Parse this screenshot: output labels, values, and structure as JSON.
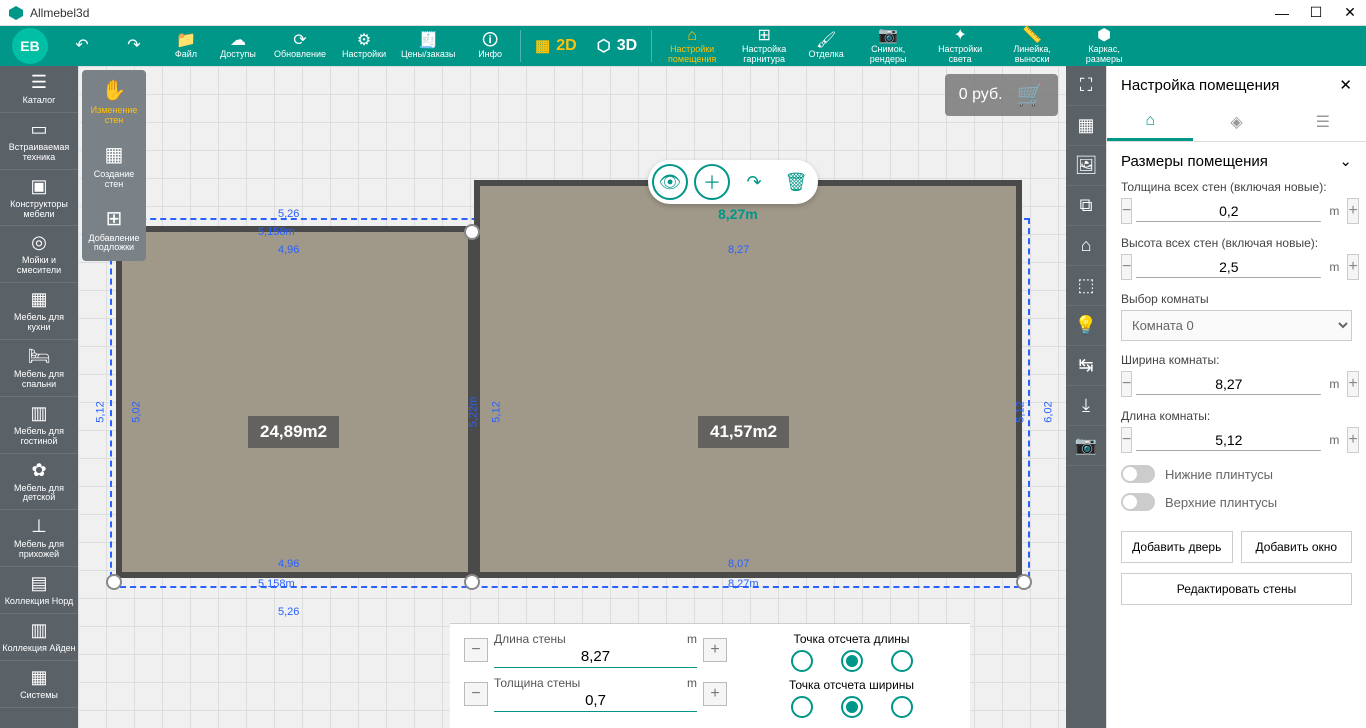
{
  "title": "Allmebel3d",
  "toolbar": {
    "eb": "ЕВ",
    "file": "Файл",
    "access": "Доступы",
    "update": "Обновление",
    "settings": "Настройки",
    "prices": "Цены/заказы",
    "info": "Инфо",
    "v2d": "2D",
    "v3d": "3D",
    "roomset_l1": "Настройки",
    "roomset_l2": "помещения",
    "furnset_l1": "Настройка",
    "furnset_l2": "гарнитура",
    "finish": "Отделка",
    "snap_l1": "Снимок,",
    "snap_l2": "рендеры",
    "light_l1": "Настройки",
    "light_l2": "света",
    "ruler_l1": "Линейка,",
    "ruler_l2": "выноски",
    "frame_l1": "Каркас,",
    "frame_l2": "размеры"
  },
  "price": "0 руб.",
  "catalog": {
    "cat": "Каталог",
    "builtin": "Встраиваемая техника",
    "furncon": "Конструкторы мебели",
    "sinks": "Мойки и смесители",
    "kitchen": "Мебель для кухни",
    "bedroom": "Мебель для спальни",
    "living": "Мебель для гостиной",
    "kids": "Мебель для детской",
    "hallway": "Мебель для прихожей",
    "nord": "Коллекция Норд",
    "iden": "Коллекция Айден",
    "systems": "Системы"
  },
  "walltools": {
    "walls": "Изменение стен",
    "create": "Создание стен",
    "bg": "Добавление подложки"
  },
  "rooms": {
    "r1": "24,89m2",
    "r2": "41,57m2",
    "sel_width": "8,27m"
  },
  "dims": {
    "d1": "5,26",
    "d2": "5,158m",
    "d3": "4,96",
    "d4": "5,12",
    "d5": "5,02",
    "d6": "5,22m",
    "d7": "8,27",
    "d8": "8,07",
    "d9": "8,27m",
    "d10": "6,02",
    "d11": "5,12"
  },
  "bottom": {
    "len_label": "Длина стены",
    "len_unit": "m",
    "len_val": "8,27",
    "thick_label": "Толщина стены",
    "thick_unit": "m",
    "thick_val": "0,7",
    "origin_len": "Точка отсчета длины",
    "origin_w": "Точка отсчета ширины"
  },
  "props": {
    "title": "Настройка помещения",
    "sec1": "Размеры помещения",
    "wall_thick": "Толщина всех стен (включая новые):",
    "wall_thick_val": "0,2",
    "wall_h": "Высота всех стен (включая новые):",
    "wall_h_val": "2,5",
    "room_sel": "Выбор комнаты",
    "room_opt": "Комната 0",
    "room_w": "Ширина комнаты:",
    "room_w_val": "8,27",
    "room_l": "Длина комнаты:",
    "room_l_val": "5,12",
    "unit": "m",
    "base_low": "Нижние плинтусы",
    "base_top": "Верхние плинтусы",
    "add_door": "Добавить дверь",
    "add_win": "Добавить окно",
    "edit_walls": "Редактировать стены"
  }
}
